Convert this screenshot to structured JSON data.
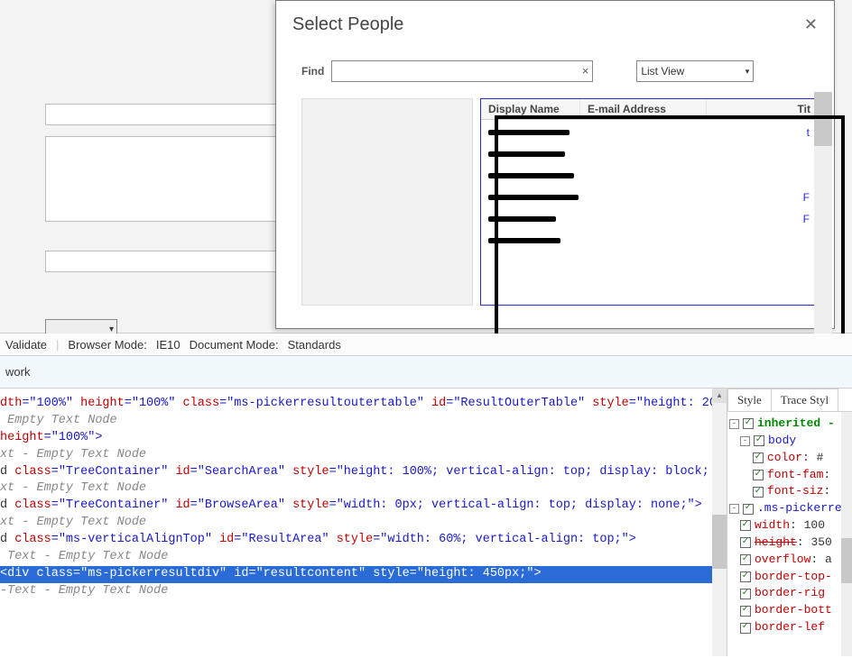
{
  "dialog": {
    "title": "Select People",
    "find_label": "Find",
    "clear_glyph": "×",
    "view_selected": "List View",
    "columns": {
      "display_name": "Display Name",
      "email": "E-mail Address",
      "title": "Tit"
    },
    "title_hints": [
      "t",
      "",
      "",
      "F",
      "F",
      ""
    ]
  },
  "dev": {
    "toolbar": {
      "validate": "Validate",
      "browser_mode_lbl": "Browser Mode:",
      "browser_mode_val": "IE10",
      "doc_mode_lbl": "Document Mode:",
      "doc_mode_val": "Standards"
    },
    "subtab": "work",
    "html_lines": [
      {
        "cls": "",
        "segs": [
          {
            "c": "red",
            "t": "dth"
          },
          {
            "c": "blue",
            "t": "=\"100%\" "
          },
          {
            "c": "red",
            "t": "height"
          },
          {
            "c": "blue",
            "t": "=\"100%\" "
          },
          {
            "c": "red",
            "t": "class"
          },
          {
            "c": "blue",
            "t": "=\"ms-pickerresultoutertable\" "
          },
          {
            "c": "red",
            "t": "id"
          },
          {
            "c": "blue",
            "t": "=\"ResultOuterTable\" "
          },
          {
            "c": "red",
            "t": "style"
          },
          {
            "c": "blue",
            "t": "=\"height: 20"
          }
        ]
      },
      {
        "cls": "grayit",
        "segs": [
          {
            "c": "",
            "t": " Empty Text Node"
          }
        ]
      },
      {
        "cls": "",
        "segs": [
          {
            "c": "",
            "t": ""
          }
        ]
      },
      {
        "cls": "",
        "segs": [
          {
            "c": "red",
            "t": "height"
          },
          {
            "c": "blue",
            "t": "=\"100%\">"
          }
        ]
      },
      {
        "cls": "grayit",
        "segs": [
          {
            "c": "",
            "t": "xt - Empty Text Node"
          }
        ]
      },
      {
        "cls": "",
        "segs": [
          {
            "c": "",
            "t": "d "
          },
          {
            "c": "red",
            "t": "class"
          },
          {
            "c": "blue",
            "t": "=\"TreeContainer\" "
          },
          {
            "c": "red",
            "t": "id"
          },
          {
            "c": "blue",
            "t": "=\"SearchArea\" "
          },
          {
            "c": "red",
            "t": "style"
          },
          {
            "c": "blue",
            "t": "=\"height: 100%; vertical-align: top; display: block;"
          }
        ]
      },
      {
        "cls": "grayit",
        "segs": [
          {
            "c": "",
            "t": "xt - Empty Text Node"
          }
        ]
      },
      {
        "cls": "",
        "segs": [
          {
            "c": "",
            "t": "d "
          },
          {
            "c": "red",
            "t": "class"
          },
          {
            "c": "blue",
            "t": "=\"TreeContainer\" "
          },
          {
            "c": "red",
            "t": "id"
          },
          {
            "c": "blue",
            "t": "=\"BrowseArea\" "
          },
          {
            "c": "red",
            "t": "style"
          },
          {
            "c": "blue",
            "t": "=\"width: 0px; vertical-align: top; display: none;\">"
          }
        ]
      },
      {
        "cls": "grayit",
        "segs": [
          {
            "c": "",
            "t": "xt - Empty Text Node"
          }
        ]
      },
      {
        "cls": "",
        "segs": [
          {
            "c": "",
            "t": "d "
          },
          {
            "c": "red",
            "t": "class"
          },
          {
            "c": "blue",
            "t": "=\"ms-verticalAlignTop\" "
          },
          {
            "c": "red",
            "t": "id"
          },
          {
            "c": "blue",
            "t": "=\"ResultArea\" "
          },
          {
            "c": "red",
            "t": "style"
          },
          {
            "c": "blue",
            "t": "=\"width: 60%; vertical-align: top;\">"
          }
        ]
      },
      {
        "cls": "grayit",
        "segs": [
          {
            "c": "",
            "t": " Text - Empty Text Node"
          }
        ]
      },
      {
        "cls": "hl",
        "segs": [
          {
            "c": "",
            "t": "<div "
          },
          {
            "c": "red",
            "t": "class"
          },
          {
            "c": "",
            "t": "=\"ms-pickerresultdiv\" "
          },
          {
            "c": "red",
            "t": "id"
          },
          {
            "c": "",
            "t": "=\"resultcontent\" "
          },
          {
            "c": "red",
            "t": "style"
          },
          {
            "c": "",
            "t": "=\"height: 450px;\">"
          }
        ]
      },
      {
        "cls": "grayit",
        "segs": [
          {
            "c": "",
            "t": "-Text - Empty Text Node"
          }
        ]
      }
    ],
    "side": {
      "tabs": [
        "Style",
        "Trace Styl"
      ],
      "root": "inherited - b",
      "body_label": "body",
      "body_rules": [
        "color: #",
        "font-fam",
        "font-siz"
      ],
      "sel_label": ".ms-pickerres",
      "sel_rules": [
        {
          "t": "width: 100",
          "s": false
        },
        {
          "t": "height: 350",
          "s": true
        },
        {
          "t": "overflow: a",
          "s": false
        },
        {
          "t": "border-top-",
          "s": false
        },
        {
          "t": "border-rig",
          "s": false
        },
        {
          "t": "border-bott",
          "s": false
        },
        {
          "t": "border-lef",
          "s": false
        }
      ]
    }
  }
}
